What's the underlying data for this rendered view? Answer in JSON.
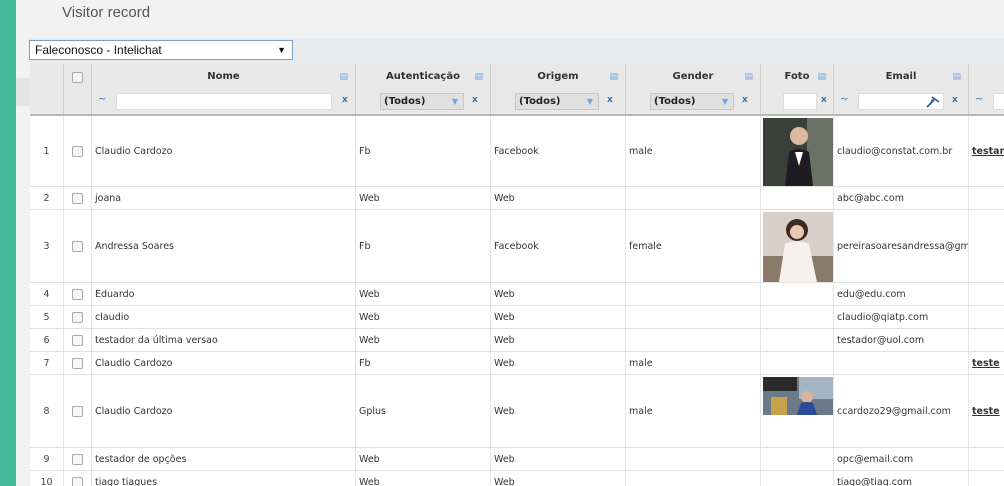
{
  "page": {
    "title": "Visitor record"
  },
  "toolbar": {
    "select_value": "Faleconosco - Intelichat"
  },
  "grid": {
    "columns": {
      "nome": "Nome",
      "autenticacao": "Autenticação",
      "origem": "Origem",
      "gender": "Gender",
      "foto": "Foto",
      "email": "Email"
    },
    "filters": {
      "tilde": "~",
      "clear": "x",
      "all_option": "(Todos)"
    },
    "rows": [
      {
        "n": "1",
        "name": "Claudio Cardozo",
        "auth": "Fb",
        "origin": "Facebook",
        "gender": "male",
        "email": "claudio@constat.com.br",
        "extra": "testan"
      },
      {
        "n": "2",
        "name": "joana",
        "auth": "Web",
        "origin": "Web",
        "gender": "",
        "email": "abc@abc.com",
        "extra": ""
      },
      {
        "n": "3",
        "name": "Andressa Soares",
        "auth": "Fb",
        "origin": "Facebook",
        "gender": "female",
        "email": "pereirasoaresandressa@gma",
        "extra": ""
      },
      {
        "n": "4",
        "name": "Eduardo",
        "auth": "Web",
        "origin": "Web",
        "gender": "",
        "email": "edu@edu.com",
        "extra": ""
      },
      {
        "n": "5",
        "name": "claudio",
        "auth": "Web",
        "origin": "Web",
        "gender": "",
        "email": "claudio@qiatp.com",
        "extra": ""
      },
      {
        "n": "6",
        "name": "testador da última versao",
        "auth": "Web",
        "origin": "Web",
        "gender": "",
        "email": "testador@uol.com",
        "extra": ""
      },
      {
        "n": "7",
        "name": "Claudio Cardozo",
        "auth": "Fb",
        "origin": "Web",
        "gender": "male",
        "email": "",
        "extra": "teste"
      },
      {
        "n": "8",
        "name": "Claudio Cardozo",
        "auth": "Gplus",
        "origin": "Web",
        "gender": "male",
        "email": "ccardozo29@gmail.com",
        "extra": "teste"
      },
      {
        "n": "9",
        "name": "testador de opções",
        "auth": "Web",
        "origin": "Web",
        "gender": "",
        "email": "opc@email.com",
        "extra": ""
      },
      {
        "n": "10",
        "name": "tiago tiagues",
        "auth": "Web",
        "origin": "Web",
        "gender": "",
        "email": "tiago@tiag.com",
        "extra": ""
      }
    ]
  },
  "icons": {
    "sort": "sort-icon",
    "clear": "clear-filter-icon",
    "pin": "pushpin-icon",
    "checkbox": "checkbox"
  }
}
